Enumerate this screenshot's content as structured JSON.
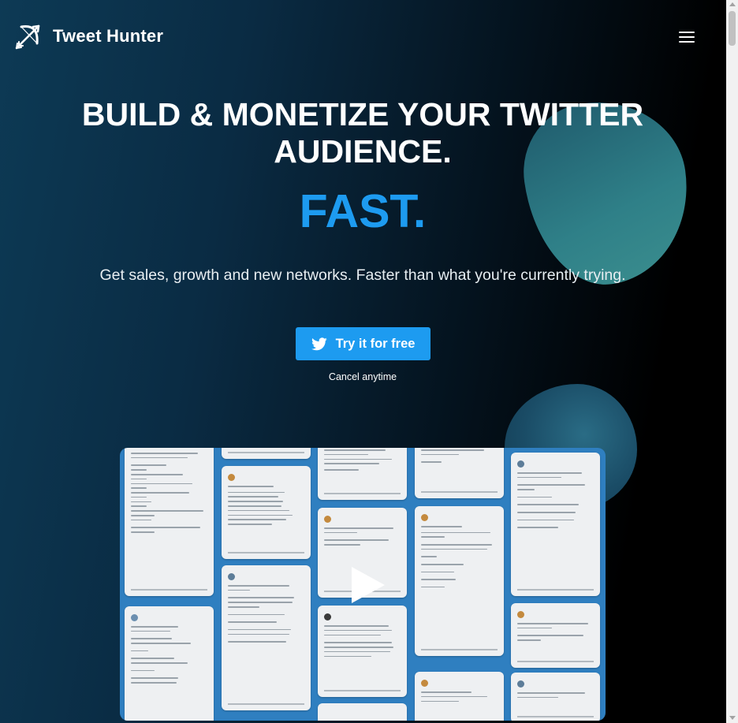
{
  "brand": {
    "name": "Tweet Hunter",
    "logo_icon": "bow-arrow-icon"
  },
  "header": {
    "menu_icon": "hamburger-menu-icon"
  },
  "hero": {
    "headline_line1": "BUILD & MONETIZE YOUR TWITTER",
    "headline_line2": "AUDIENCE.",
    "accent_word": "FAST.",
    "subheadline": "Get sales, growth and new networks. Faster than what you're currently trying.",
    "cta_label": "Try it for free",
    "cta_icon": "twitter-bird-icon",
    "cancel_note": "Cancel anytime"
  },
  "video": {
    "play_icon": "play-icon"
  },
  "colors": {
    "accent": "#1d9bf0",
    "cta_background": "#1d9bf0",
    "video_background": "#2f7fc0",
    "text": "#ffffff"
  }
}
